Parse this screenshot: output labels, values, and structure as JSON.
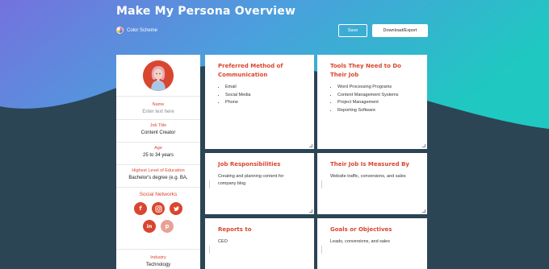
{
  "header": {
    "title": "Make My Persona Overview",
    "color_scheme_label": "Color Scheme",
    "save_label": "Save",
    "export_label": "Download/Export"
  },
  "colors": {
    "accent": "#d9462f",
    "bg_dark": "#2b4555",
    "gradient_start": "#6b7fe0",
    "gradient_end": "#1fc7c3"
  },
  "sidebar": {
    "fields": [
      {
        "label": "Name",
        "value": "Enter text here"
      },
      {
        "label": "Job Title",
        "value": "Content Creator"
      },
      {
        "label": "Age",
        "value": "25 to 34 years"
      },
      {
        "label": "Highest Level of Education",
        "value": "Bachelor's degree (e.g. BA,"
      }
    ],
    "social_title": "Social Networks",
    "socials": [
      "facebook-icon",
      "instagram-icon",
      "twitter-icon",
      "linkedin-icon",
      "pinterest-icon"
    ],
    "industry": {
      "label": "Industry",
      "value": "Technology"
    }
  },
  "cards": {
    "communication": {
      "title": "Preferred Method of Communication",
      "items": [
        "Email",
        "Social Media",
        "Phone"
      ]
    },
    "tools": {
      "title": "Tools They Need to Do Their Job",
      "items": [
        "Word Processing Programs",
        "Content Management Systems",
        "Project Management",
        "Reporting Software"
      ]
    },
    "responsibilities": {
      "title": "Job Responsibilities",
      "text": "Creating and planning content for company blog"
    },
    "measured": {
      "title": "Their Job Is Measured By",
      "text": "Website traffic, conversions, and sales"
    },
    "reports": {
      "title": "Reports to",
      "text": "CEO"
    },
    "goals": {
      "title": "Goals or Objectives",
      "text": "Leads, conversions, and sales"
    }
  }
}
